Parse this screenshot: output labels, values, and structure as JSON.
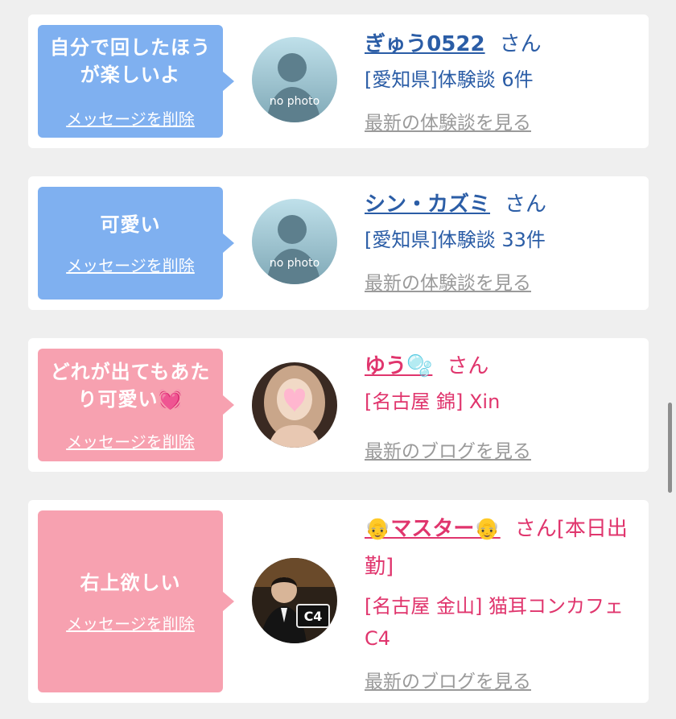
{
  "cards": [
    {
      "message": "自分で回したほうが楽しいよ",
      "delete_label": "メッセージを削除",
      "avatar_text": "no photo",
      "name": "ぎゅう0522",
      "honorific": "さん",
      "detail": "[愛知県]体験談 6件",
      "latest_link": "最新の体験談を見る"
    },
    {
      "message": "可愛い",
      "delete_label": "メッセージを削除",
      "avatar_text": "no photo",
      "name": "シン・カズミ",
      "honorific": "さん",
      "detail": "[愛知県]体験談 33件",
      "latest_link": "最新の体験談を見る"
    },
    {
      "message": "どれが出てもあたり可愛い💓",
      "delete_label": "メッセージを削除",
      "name": "ゆう🫧",
      "honorific": "さん",
      "detail": "[名古屋 錦] Xin",
      "latest_link": "最新のブログを見る"
    },
    {
      "message": "右上欲しい",
      "delete_label": "メッセージを削除",
      "avatar_sign": "C4",
      "name": "👴マスター👴",
      "honorific": "さん[本日出勤]",
      "detail": "[名古屋 金山] 猫耳コンカフェ C4",
      "latest_link": "最新のブログを見る"
    }
  ],
  "colors": {
    "blue_bubble": "#7fb0f0",
    "pink_bubble": "#f7a1b0",
    "blue_text": "#2b5da6",
    "pink_text": "#e0356d",
    "link_gray": "#9a9a9a"
  },
  "icons": [
    "no-photo-avatar",
    "user-photo-avatar"
  ]
}
